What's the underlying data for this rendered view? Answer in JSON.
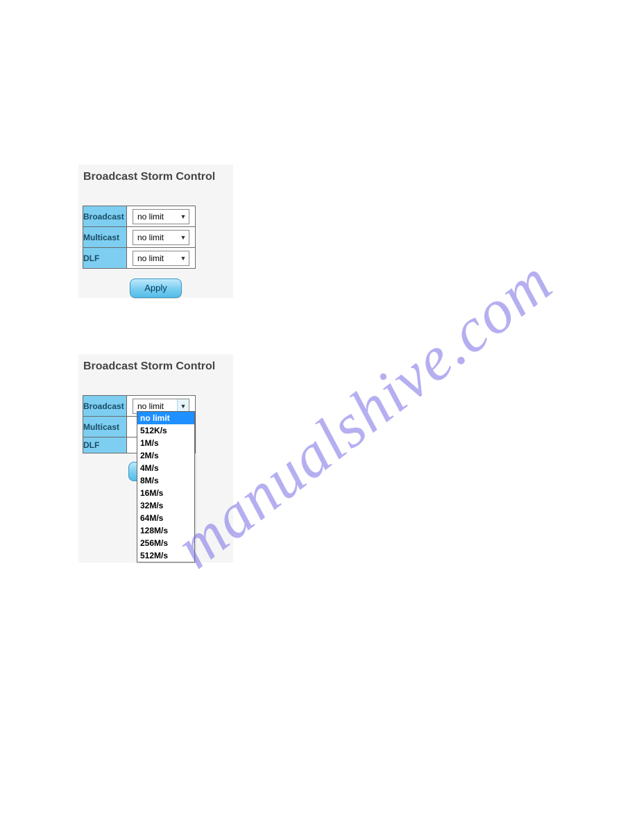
{
  "watermark": "manualshive.com",
  "section1": {
    "heading": "Broadcast Storm Control",
    "rows": [
      {
        "label": "Broadcast",
        "value": "no limit"
      },
      {
        "label": "Multicast",
        "value": "no limit"
      },
      {
        "label": "DLF",
        "value": "no limit"
      }
    ],
    "apply_label": "Apply"
  },
  "section2": {
    "heading": "Broadcast Storm Control",
    "rows": [
      {
        "label": "Broadcast",
        "value": "no limit"
      },
      {
        "label": "Multicast",
        "value": ""
      },
      {
        "label": "DLF",
        "value": ""
      }
    ],
    "dropdown_options": [
      "no limit",
      "512K/s",
      "1M/s",
      "2M/s",
      "4M/s",
      "8M/s",
      "16M/s",
      "32M/s",
      "64M/s",
      "128M/s",
      "256M/s",
      "512M/s"
    ],
    "dropdown_selected": "no limit"
  }
}
